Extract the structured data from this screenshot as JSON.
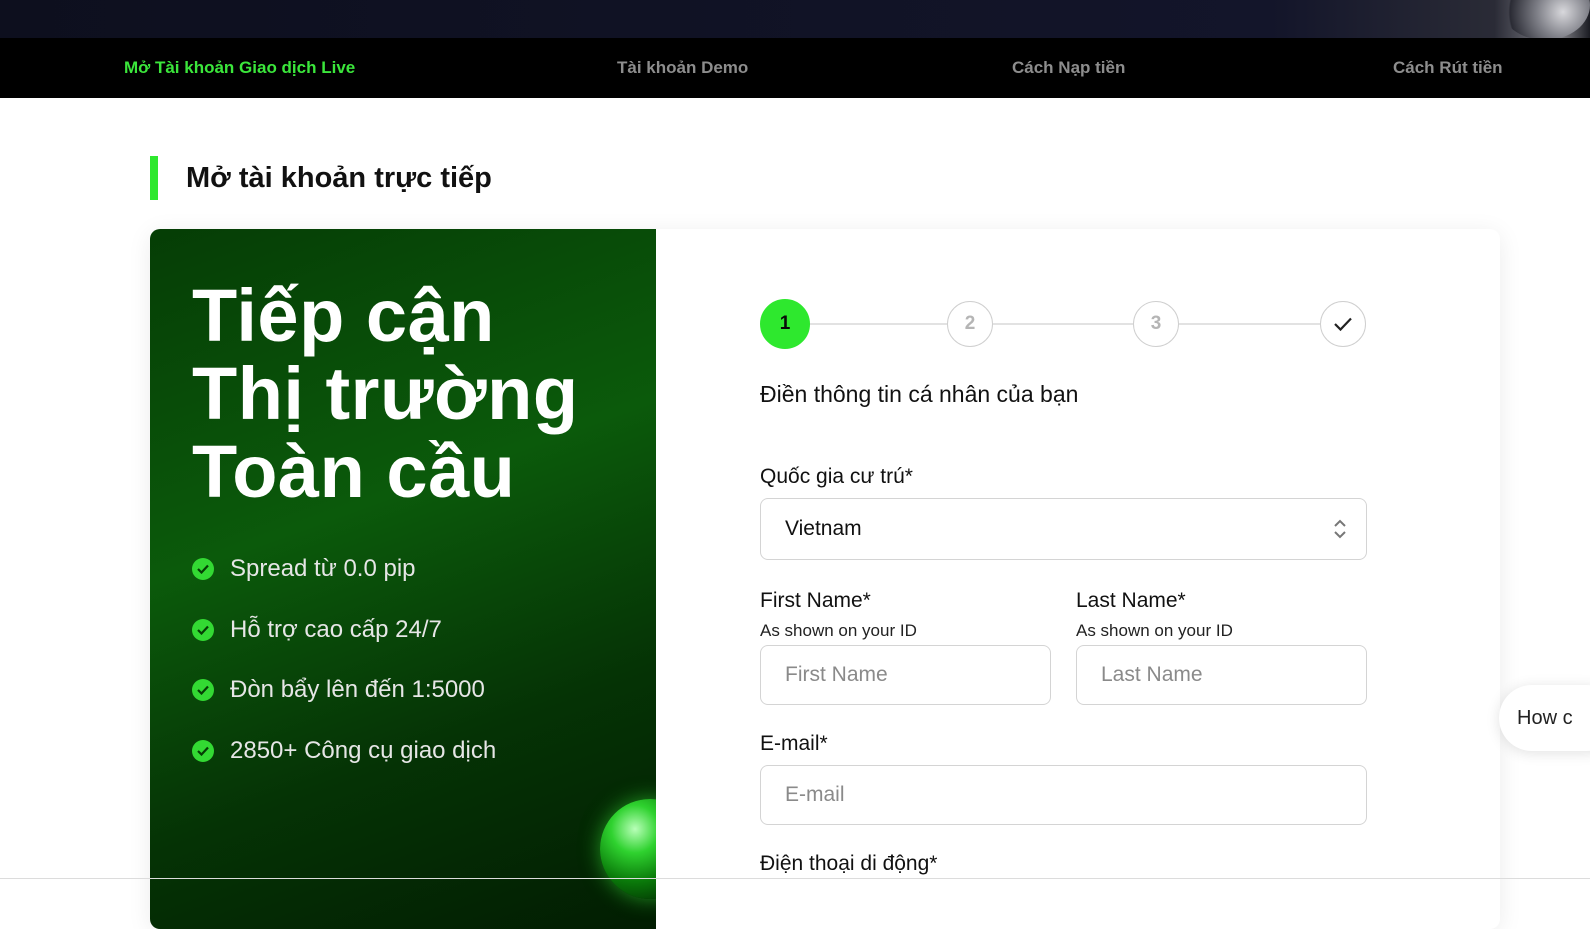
{
  "subnav": {
    "items": [
      {
        "label": "Mở Tài khoản Giao dịch Live",
        "active": true
      },
      {
        "label": "Tài khoản Demo",
        "active": false
      },
      {
        "label": "Cách Nạp tiền",
        "active": false
      },
      {
        "label": "Cách Rút tiền",
        "active": false
      }
    ]
  },
  "section": {
    "title": "Mở tài khoản trực tiếp"
  },
  "promo": {
    "headline": [
      "Tiếp cận",
      "Thị trường",
      "Toàn cầu"
    ],
    "features": [
      "Spread từ 0.0 pip",
      "Hỗ trợ cao cấp 24/7",
      "Đòn bẩy lên đến 1:5000",
      "2850+ Công cụ giao dịch"
    ],
    "check_icon": "check-circle-icon",
    "accent_color": "#2ee82e"
  },
  "stepper": {
    "steps": [
      "1",
      "2",
      "3"
    ],
    "final_icon": "checkmark-icon",
    "active_step": 1
  },
  "form": {
    "title": "Điền thông tin cá nhân của bạn",
    "country": {
      "label": "Quốc gia cư trú*",
      "value": "Vietnam"
    },
    "first_name": {
      "label": "First Name*",
      "hint": "As shown on your ID",
      "placeholder": "First Name"
    },
    "last_name": {
      "label": "Last Name*",
      "hint": "As shown on your ID",
      "placeholder": "Last Name"
    },
    "email": {
      "label": "E-mail*",
      "placeholder": "E-mail"
    },
    "phone": {
      "label": "Điện thoại di động*"
    }
  },
  "chat": {
    "label": "How c"
  }
}
